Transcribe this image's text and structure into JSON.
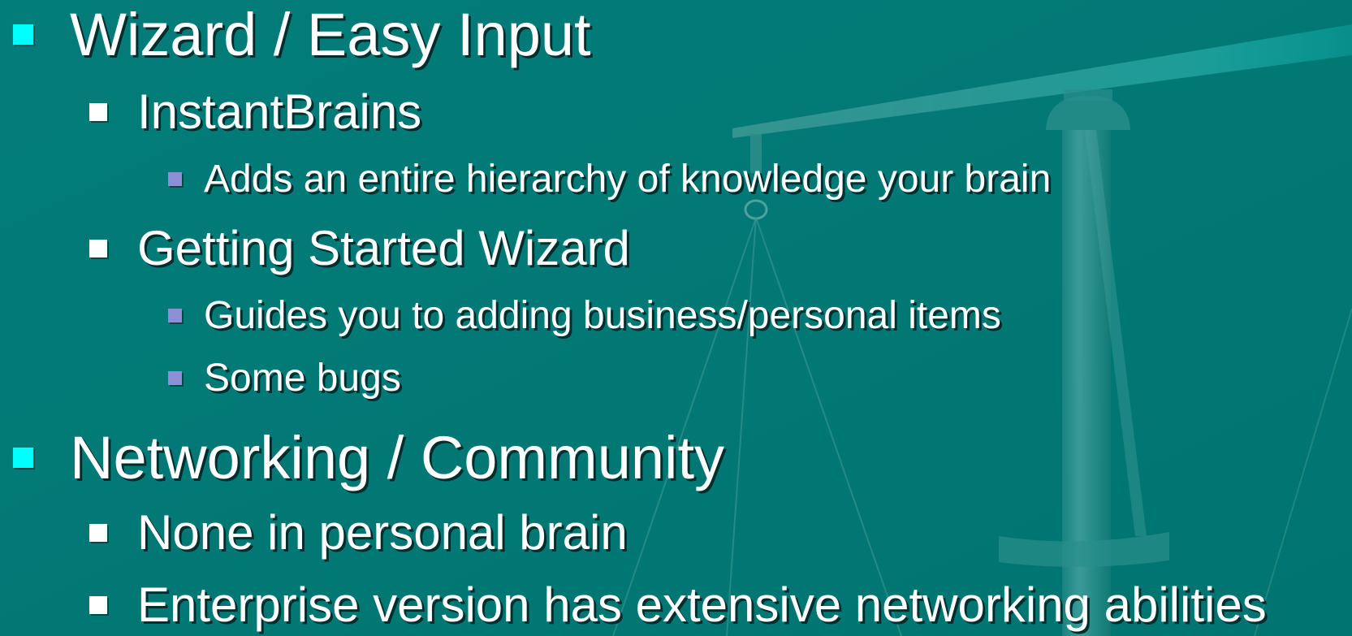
{
  "slide": {
    "bullets": [
      {
        "label": "Wizard / Easy Input",
        "children": [
          {
            "label": "InstantBrains",
            "children": [
              {
                "label": "Adds an entire hierarchy of knowledge your brain"
              }
            ]
          },
          {
            "label": "Getting Started Wizard",
            "children": [
              {
                "label": "Guides you to adding business/personal items"
              },
              {
                "label": "Some bugs"
              }
            ]
          }
        ]
      },
      {
        "label": "Networking / Community",
        "children": [
          {
            "label": "None in personal brain"
          },
          {
            "label": "Enterprise version has extensive networking abilities"
          }
        ]
      }
    ]
  },
  "colors": {
    "background": "#007b78",
    "text": "#ffffff",
    "level1_bullet": "#00ffff",
    "level2_bullet": "#ffffff",
    "level3_bullet": "#8c8fd6"
  },
  "background_graphic": {
    "icon": "balance-scale-icon"
  }
}
